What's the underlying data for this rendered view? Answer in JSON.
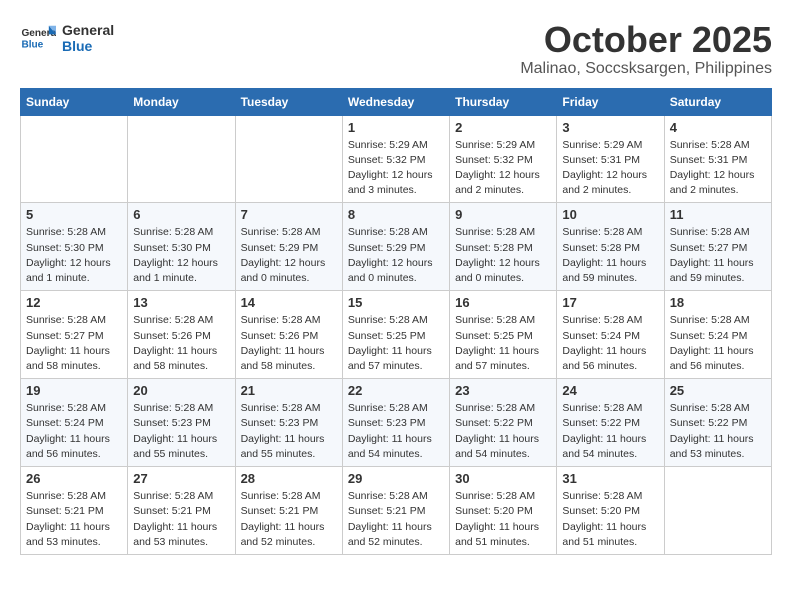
{
  "header": {
    "logo_line1": "General",
    "logo_line2": "Blue",
    "month_title": "October 2025",
    "location": "Malinao, Soccsksargen, Philippines"
  },
  "weekdays": [
    "Sunday",
    "Monday",
    "Tuesday",
    "Wednesday",
    "Thursday",
    "Friday",
    "Saturday"
  ],
  "weeks": [
    [
      {
        "day": "",
        "info": ""
      },
      {
        "day": "",
        "info": ""
      },
      {
        "day": "",
        "info": ""
      },
      {
        "day": "1",
        "info": "Sunrise: 5:29 AM\nSunset: 5:32 PM\nDaylight: 12 hours and 3 minutes."
      },
      {
        "day": "2",
        "info": "Sunrise: 5:29 AM\nSunset: 5:32 PM\nDaylight: 12 hours and 2 minutes."
      },
      {
        "day": "3",
        "info": "Sunrise: 5:29 AM\nSunset: 5:31 PM\nDaylight: 12 hours and 2 minutes."
      },
      {
        "day": "4",
        "info": "Sunrise: 5:28 AM\nSunset: 5:31 PM\nDaylight: 12 hours and 2 minutes."
      }
    ],
    [
      {
        "day": "5",
        "info": "Sunrise: 5:28 AM\nSunset: 5:30 PM\nDaylight: 12 hours and 1 minute."
      },
      {
        "day": "6",
        "info": "Sunrise: 5:28 AM\nSunset: 5:30 PM\nDaylight: 12 hours and 1 minute."
      },
      {
        "day": "7",
        "info": "Sunrise: 5:28 AM\nSunset: 5:29 PM\nDaylight: 12 hours and 0 minutes."
      },
      {
        "day": "8",
        "info": "Sunrise: 5:28 AM\nSunset: 5:29 PM\nDaylight: 12 hours and 0 minutes."
      },
      {
        "day": "9",
        "info": "Sunrise: 5:28 AM\nSunset: 5:28 PM\nDaylight: 12 hours and 0 minutes."
      },
      {
        "day": "10",
        "info": "Sunrise: 5:28 AM\nSunset: 5:28 PM\nDaylight: 11 hours and 59 minutes."
      },
      {
        "day": "11",
        "info": "Sunrise: 5:28 AM\nSunset: 5:27 PM\nDaylight: 11 hours and 59 minutes."
      }
    ],
    [
      {
        "day": "12",
        "info": "Sunrise: 5:28 AM\nSunset: 5:27 PM\nDaylight: 11 hours and 58 minutes."
      },
      {
        "day": "13",
        "info": "Sunrise: 5:28 AM\nSunset: 5:26 PM\nDaylight: 11 hours and 58 minutes."
      },
      {
        "day": "14",
        "info": "Sunrise: 5:28 AM\nSunset: 5:26 PM\nDaylight: 11 hours and 58 minutes."
      },
      {
        "day": "15",
        "info": "Sunrise: 5:28 AM\nSunset: 5:25 PM\nDaylight: 11 hours and 57 minutes."
      },
      {
        "day": "16",
        "info": "Sunrise: 5:28 AM\nSunset: 5:25 PM\nDaylight: 11 hours and 57 minutes."
      },
      {
        "day": "17",
        "info": "Sunrise: 5:28 AM\nSunset: 5:24 PM\nDaylight: 11 hours and 56 minutes."
      },
      {
        "day": "18",
        "info": "Sunrise: 5:28 AM\nSunset: 5:24 PM\nDaylight: 11 hours and 56 minutes."
      }
    ],
    [
      {
        "day": "19",
        "info": "Sunrise: 5:28 AM\nSunset: 5:24 PM\nDaylight: 11 hours and 56 minutes."
      },
      {
        "day": "20",
        "info": "Sunrise: 5:28 AM\nSunset: 5:23 PM\nDaylight: 11 hours and 55 minutes."
      },
      {
        "day": "21",
        "info": "Sunrise: 5:28 AM\nSunset: 5:23 PM\nDaylight: 11 hours and 55 minutes."
      },
      {
        "day": "22",
        "info": "Sunrise: 5:28 AM\nSunset: 5:23 PM\nDaylight: 11 hours and 54 minutes."
      },
      {
        "day": "23",
        "info": "Sunrise: 5:28 AM\nSunset: 5:22 PM\nDaylight: 11 hours and 54 minutes."
      },
      {
        "day": "24",
        "info": "Sunrise: 5:28 AM\nSunset: 5:22 PM\nDaylight: 11 hours and 54 minutes."
      },
      {
        "day": "25",
        "info": "Sunrise: 5:28 AM\nSunset: 5:22 PM\nDaylight: 11 hours and 53 minutes."
      }
    ],
    [
      {
        "day": "26",
        "info": "Sunrise: 5:28 AM\nSunset: 5:21 PM\nDaylight: 11 hours and 53 minutes."
      },
      {
        "day": "27",
        "info": "Sunrise: 5:28 AM\nSunset: 5:21 PM\nDaylight: 11 hours and 53 minutes."
      },
      {
        "day": "28",
        "info": "Sunrise: 5:28 AM\nSunset: 5:21 PM\nDaylight: 11 hours and 52 minutes."
      },
      {
        "day": "29",
        "info": "Sunrise: 5:28 AM\nSunset: 5:21 PM\nDaylight: 11 hours and 52 minutes."
      },
      {
        "day": "30",
        "info": "Sunrise: 5:28 AM\nSunset: 5:20 PM\nDaylight: 11 hours and 51 minutes."
      },
      {
        "day": "31",
        "info": "Sunrise: 5:28 AM\nSunset: 5:20 PM\nDaylight: 11 hours and 51 minutes."
      },
      {
        "day": "",
        "info": ""
      }
    ]
  ]
}
